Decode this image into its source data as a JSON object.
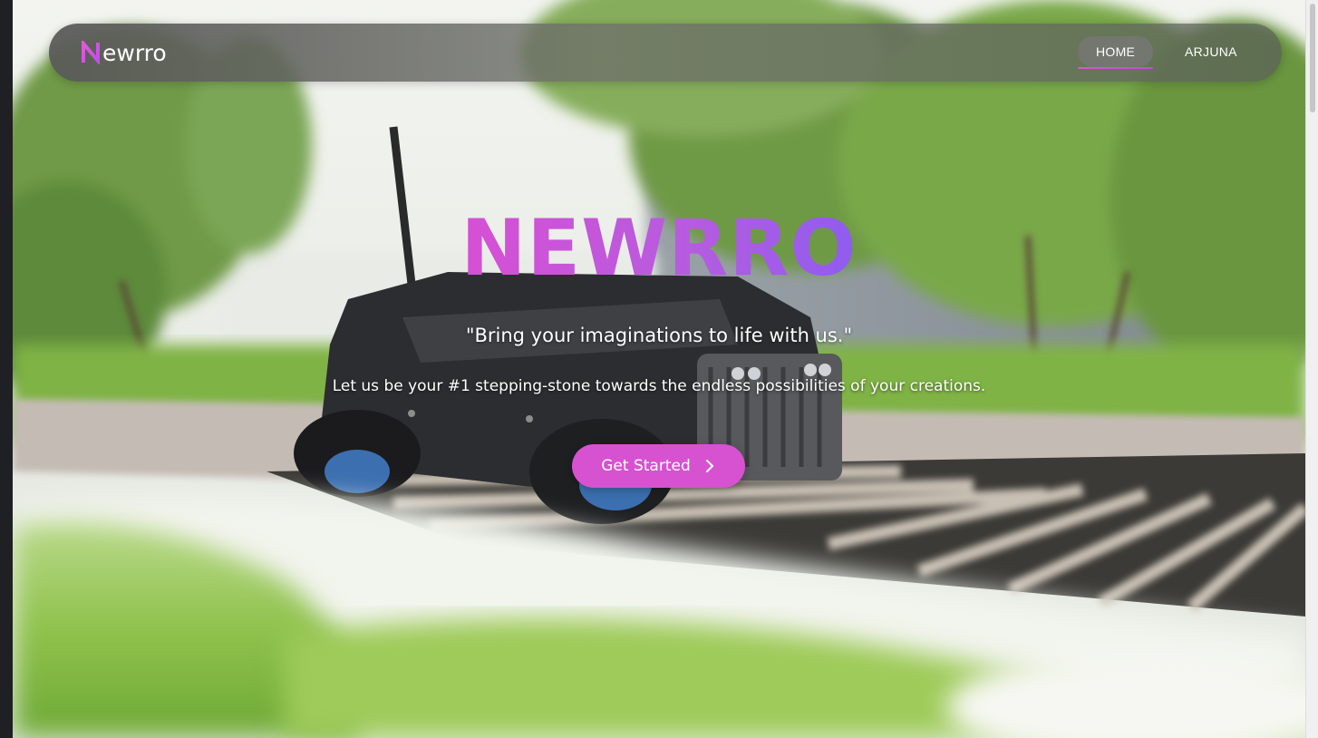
{
  "navbar": {
    "logo_text": "ewrro",
    "links": [
      {
        "label": "HOME",
        "active": true
      },
      {
        "label": "ARJUNA",
        "active": false
      }
    ]
  },
  "hero": {
    "title": "NEWRRO",
    "quote": "\"Bring your imaginations to life with us.\"",
    "subtitle": "Let us be your #1 stepping-stone towards the endless possibilities of your creations.",
    "cta_label": "Get Started",
    "cta_icon": "chevron-right-icon",
    "background_image": "robot-rover-on-grate-in-garden"
  },
  "colors": {
    "accent": "#d752d0",
    "gradient_end": "#8f5cf0"
  }
}
